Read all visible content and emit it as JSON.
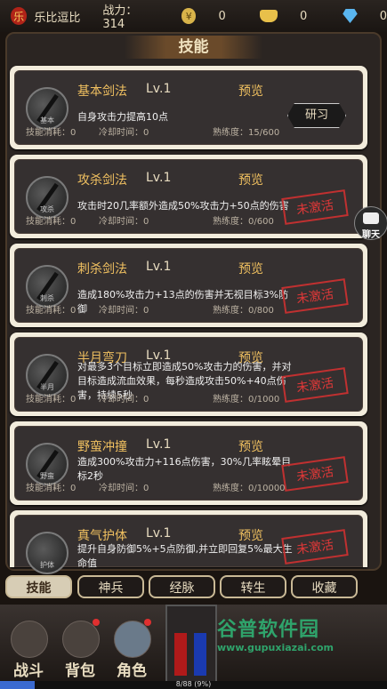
{
  "topbar": {
    "guild_icon_char": "乐",
    "player_name": "乐比逗比",
    "power_label": "战力：314",
    "coin_value": "0",
    "ingot_value": "0",
    "gem_value": "0"
  },
  "page_title": "技能",
  "chat_label": "聊天",
  "skills": [
    {
      "name": "基本剑法",
      "level": "Lv.1",
      "preview": "预览",
      "desc": "自身攻击力提高10点",
      "icon_caption": "基本",
      "cost": "技能消耗：0",
      "cooldown": "冷却时间：0",
      "mastery": "熟练度：15/600",
      "action": "研习",
      "locked": false
    },
    {
      "name": "攻杀剑法",
      "level": "Lv.1",
      "preview": "预览",
      "desc": "攻击时20几率额外造成50%攻击力+50点的伤害",
      "icon_caption": "攻杀",
      "cost": "技能消耗：0",
      "cooldown": "冷却时间：0",
      "mastery": "熟练度：0/600",
      "stamp": "未激活",
      "locked": true
    },
    {
      "name": "刺杀剑法",
      "level": "Lv.1",
      "preview": "预览",
      "desc": "造成180%攻击力+13点的伤害并无视目标3%防御",
      "icon_caption": "刺杀",
      "cost": "技能消耗：0",
      "cooldown": "冷却时间：0",
      "mastery": "熟练度：0/800",
      "stamp": "未激活",
      "locked": true
    },
    {
      "name": "半月弯刀",
      "level": "Lv.1",
      "preview": "预览",
      "desc": "对最多3个目标立即造成50%攻击力的伤害，并对目标造成流血效果，每秒造成攻击50%+40点伤害，持续5秒",
      "icon_caption": "半月",
      "cost": "技能消耗：0",
      "cooldown": "冷却时间：0",
      "mastery": "熟练度：0/1000",
      "stamp": "未激活",
      "locked": true
    },
    {
      "name": "野蛮冲撞",
      "level": "Lv.1",
      "preview": "预览",
      "desc": "造成300%攻击力+116点伤害，30%几率眩晕目标2秒",
      "icon_caption": "野蛮",
      "cost": "技能消耗：0",
      "cooldown": "冷却时间：0",
      "mastery": "熟练度：0/10000",
      "stamp": "未激活",
      "locked": true
    },
    {
      "name": "真气护体",
      "level": "Lv.1",
      "preview": "预览",
      "desc": "提升自身防御5%+5点防御,并立即回复5%最大生命值",
      "icon_caption": "护体",
      "stamp": "未激活",
      "locked": true
    }
  ],
  "tabs": [
    "技能",
    "神兵",
    "经脉",
    "转生",
    "收藏"
  ],
  "bottom_nav": [
    "战斗",
    "背包",
    "角色"
  ],
  "progress": {
    "text": "8/88 (9%)",
    "value": 0.09
  },
  "watermark": {
    "brand": "谷普软件园",
    "url": "www.gupuxiazai.com"
  },
  "colors": {
    "accent": "#f0c060",
    "stamp": "#e03838",
    "background": "#1a1410"
  }
}
